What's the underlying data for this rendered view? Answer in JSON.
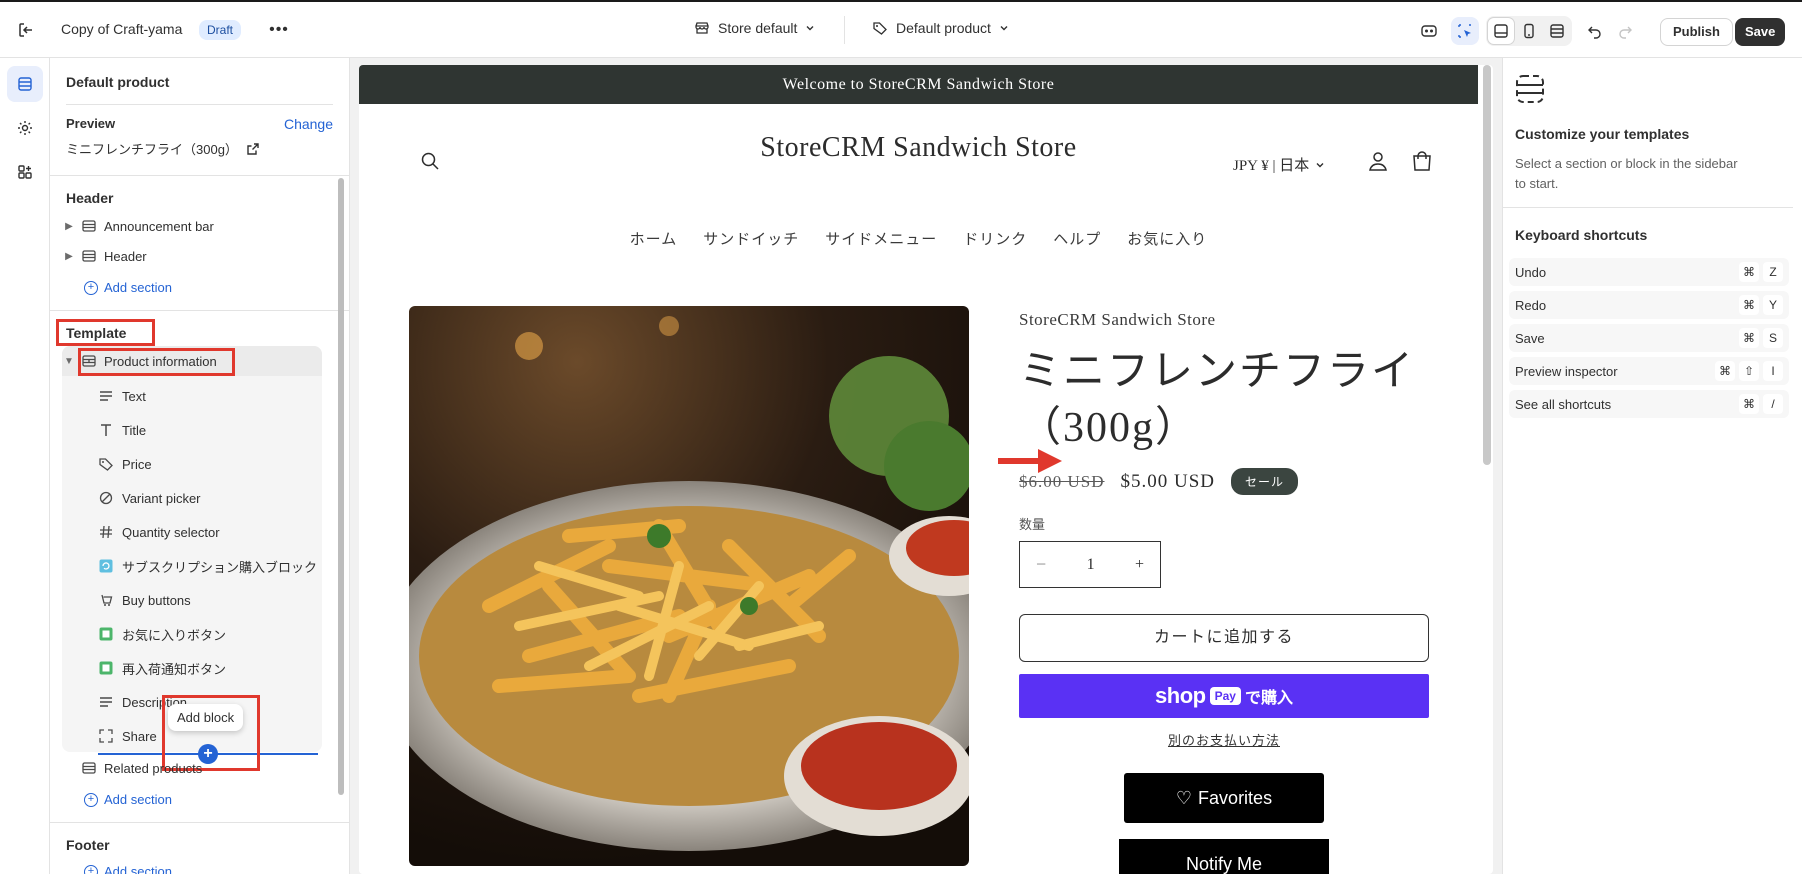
{
  "topbar": {
    "title": "Copy of Craft-yama",
    "badge": "Draft",
    "more": "•••",
    "store_select": "Store default",
    "template_select": "Default product",
    "publish": "Publish",
    "save": "Save"
  },
  "sidebar": {
    "title": "Default product",
    "preview_label": "Preview",
    "change_label": "Change",
    "preview_value": "ミニフレンチフライ（300g）",
    "header_group": "Header",
    "header_items": [
      {
        "label": "Announcement bar"
      },
      {
        "label": "Header"
      }
    ],
    "add_section": "Add section",
    "template_group": "Template",
    "section_label": "Product information",
    "blocks": [
      {
        "label": "Text",
        "icon": "text-icon"
      },
      {
        "label": "Title",
        "icon": "title-icon"
      },
      {
        "label": "Price",
        "icon": "price-tag-icon"
      },
      {
        "label": "Variant picker",
        "icon": "variant-icon"
      },
      {
        "label": "Quantity selector",
        "icon": "hash-icon"
      },
      {
        "label": "サブスクリプション購入ブロック",
        "icon": "app-block-icon"
      },
      {
        "label": "Buy buttons",
        "icon": "buy-button-icon"
      },
      {
        "label": "お気に入りボタン",
        "icon": "app-block-icon"
      },
      {
        "label": "再入荷通知ボタン",
        "icon": "app-block-icon"
      },
      {
        "label": "Description",
        "icon": "text-icon"
      },
      {
        "label": "Share",
        "icon": "share-icon"
      }
    ],
    "related_products": "Related products",
    "add_section_2": "Add section",
    "footer_group": "Footer",
    "add_section_3": "Add section",
    "tooltip": "Add block"
  },
  "preview": {
    "announcement": "Welcome to StoreCRM Sandwich Store",
    "store_name": "StoreCRM Sandwich Store",
    "locale": "JPY ¥ | 日本",
    "nav": [
      "ホーム",
      "サンドイッチ",
      "サイドメニュー",
      "ドリンク",
      "ヘルプ",
      "お気に入り"
    ],
    "product": {
      "vendor": "StoreCRM Sandwich Store",
      "title": "ミニフレンチフライ（300g）",
      "compare_price": "$6.00 USD",
      "price": "$5.00 USD",
      "sale_badge": "セール",
      "quantity_label": "数量",
      "quantity": "1",
      "add_to_cart": "カートに追加する",
      "shop_pay_brand": "shop",
      "shop_pay_pay": "Pay",
      "shop_pay_buy": "で購入",
      "more_payment": "別のお支払い方法",
      "favorites": "Favorites",
      "notify": "Notify Me"
    }
  },
  "right_panel": {
    "title": "Customize your templates",
    "description": "Select a section or block in the sidebar to start.",
    "shortcuts_title": "Keyboard shortcuts",
    "shortcuts": [
      {
        "label": "Undo",
        "keys": [
          "⌘",
          "Z"
        ]
      },
      {
        "label": "Redo",
        "keys": [
          "⌘",
          "Y"
        ]
      },
      {
        "label": "Save",
        "keys": [
          "⌘",
          "S"
        ]
      },
      {
        "label": "Preview inspector",
        "keys": [
          "⌘",
          "⇧",
          "I"
        ]
      },
      {
        "label": "See all shortcuts",
        "keys": [
          "⌘",
          "/"
        ]
      }
    ]
  },
  "colors": {
    "accent": "#2463d4",
    "highlight": "#e0382d",
    "shop_pay": "#5a31f4",
    "announcement_bg": "#2f3532"
  }
}
